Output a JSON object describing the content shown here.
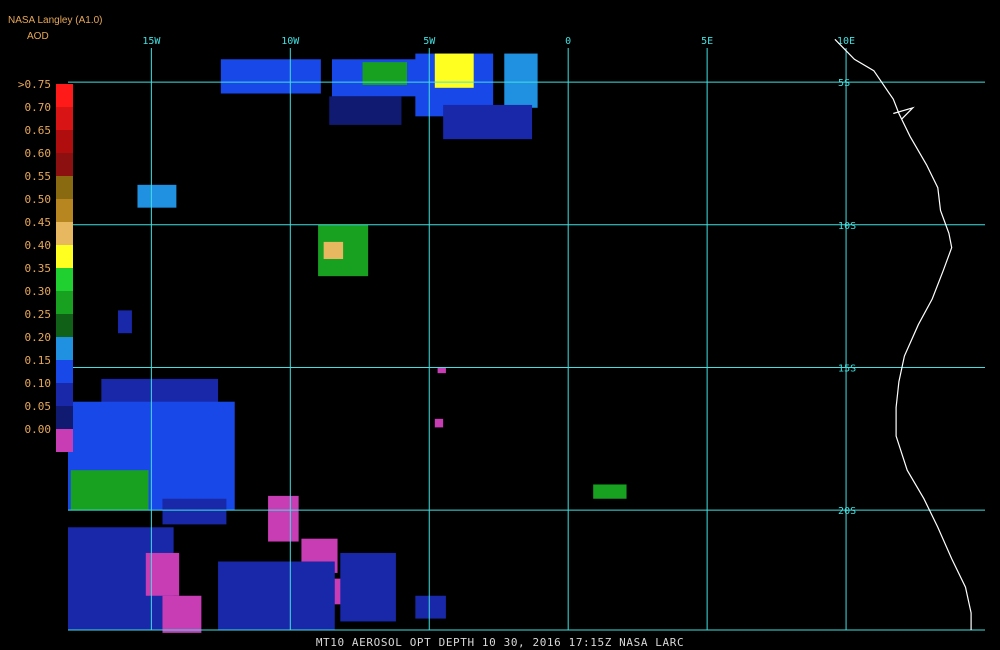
{
  "header": {
    "source": "NASA Langley (A1.0)",
    "variable": "AOD"
  },
  "footer": {
    "caption": "MT10  AEROSOL OPT DEPTH   10 30, 2016 17:15Z   NASA LARC"
  },
  "map": {
    "lon_min": -18,
    "lon_max": 15,
    "lat_max": -3.7,
    "lat_min": -24.2,
    "grid_color": "#40e0e0",
    "coast_color": "#ffffff",
    "lon_lines": [
      {
        "lon": -15,
        "label": "15W"
      },
      {
        "lon": -10,
        "label": "10W"
      },
      {
        "lon": -5,
        "label": "5W"
      },
      {
        "lon": 0,
        "label": "0"
      },
      {
        "lon": 5,
        "label": "5E"
      },
      {
        "lon": 10,
        "label": "10E"
      }
    ],
    "lat_lines": [
      {
        "lat": -5,
        "label": "5S"
      },
      {
        "lat": -10,
        "label": "10S"
      },
      {
        "lat": -15,
        "label": "15S"
      },
      {
        "lat": -20,
        "label": "20S"
      }
    ],
    "coastline": [
      [
        9.6,
        -3.5
      ],
      [
        10.3,
        -4.2
      ],
      [
        11.0,
        -4.6
      ],
      [
        11.7,
        -5.6
      ],
      [
        11.9,
        -6.1
      ],
      [
        12.3,
        -6.9
      ],
      [
        12.9,
        -7.9
      ],
      [
        13.3,
        -8.7
      ],
      [
        13.4,
        -9.5
      ],
      [
        13.7,
        -10.3
      ],
      [
        13.8,
        -10.8
      ],
      [
        13.5,
        -11.6
      ],
      [
        13.1,
        -12.6
      ],
      [
        12.6,
        -13.5
      ],
      [
        12.1,
        -14.6
      ],
      [
        11.9,
        -15.5
      ],
      [
        11.8,
        -16.4
      ],
      [
        11.8,
        -17.4
      ],
      [
        12.2,
        -18.6
      ],
      [
        12.8,
        -19.6
      ],
      [
        13.3,
        -20.6
      ],
      [
        13.8,
        -21.7
      ],
      [
        14.3,
        -22.7
      ],
      [
        14.5,
        -23.6
      ],
      [
        14.5,
        -24.2
      ]
    ],
    "coast_inlet": [
      [
        11.7,
        -6.1
      ],
      [
        12.4,
        -5.9
      ],
      [
        12.0,
        -6.3
      ]
    ],
    "aerosol_patches": [
      {
        "lon": -12.5,
        "lat": -4.2,
        "w": 3.6,
        "h": 1.2,
        "aod": 0.15
      },
      {
        "lon": -8.5,
        "lat": -4.2,
        "w": 3.5,
        "h": 1.3,
        "aod": 0.15
      },
      {
        "lon": -5.5,
        "lat": -4.0,
        "w": 2.8,
        "h": 2.2,
        "aod": 0.15
      },
      {
        "lon": -2.3,
        "lat": -4.0,
        "w": 1.2,
        "h": 1.9,
        "aod": 0.2
      },
      {
        "lon": -8.6,
        "lat": -5.5,
        "w": 2.6,
        "h": 1.0,
        "aod": 0.05
      },
      {
        "lon": -4.5,
        "lat": -5.8,
        "w": 3.2,
        "h": 1.2,
        "aod": 0.1
      },
      {
        "lon": -7.4,
        "lat": -4.3,
        "w": 1.6,
        "h": 0.8,
        "aod": 0.3
      },
      {
        "lon": -4.8,
        "lat": -4.0,
        "w": 1.4,
        "h": 1.2,
        "aod": 0.4
      },
      {
        "lon": -9.0,
        "lat": -10.0,
        "w": 1.8,
        "h": 1.8,
        "aod": 0.3
      },
      {
        "lon": -8.8,
        "lat": -10.6,
        "w": 0.7,
        "h": 0.6,
        "aod": 0.45
      },
      {
        "lon": -15.5,
        "lat": -8.6,
        "w": 1.4,
        "h": 0.8,
        "aod": 0.2
      },
      {
        "lon": -16.8,
        "lat": -15.4,
        "w": 4.2,
        "h": 2.0,
        "aod": 0.1
      },
      {
        "lon": -18.0,
        "lat": -16.2,
        "w": 6.0,
        "h": 3.8,
        "aod": 0.15
      },
      {
        "lon": -17.9,
        "lat": -18.6,
        "w": 2.8,
        "h": 1.4,
        "aod": 0.3
      },
      {
        "lon": -18.0,
        "lat": -20.6,
        "w": 3.8,
        "h": 3.6,
        "aod": 0.1
      },
      {
        "lon": -15.2,
        "lat": -21.5,
        "w": 1.2,
        "h": 1.5,
        "aod": 0.0
      },
      {
        "lon": -14.6,
        "lat": -23.0,
        "w": 1.4,
        "h": 1.3,
        "aod": 0.0
      },
      {
        "lon": -10.8,
        "lat": -19.5,
        "w": 1.1,
        "h": 1.6,
        "aod": 0.0
      },
      {
        "lon": -9.6,
        "lat": -21.0,
        "w": 1.3,
        "h": 1.2,
        "aod": 0.0
      },
      {
        "lon": -9.2,
        "lat": -22.4,
        "w": 1.4,
        "h": 0.9,
        "aod": 0.0
      },
      {
        "lon": -12.6,
        "lat": -21.8,
        "w": 4.2,
        "h": 2.4,
        "aod": 0.1
      },
      {
        "lon": -8.2,
        "lat": -21.5,
        "w": 2.0,
        "h": 2.4,
        "aod": 0.1
      },
      {
        "lon": -14.6,
        "lat": -19.6,
        "w": 2.3,
        "h": 0.9,
        "aod": 0.1
      },
      {
        "lon": -5.5,
        "lat": -23.0,
        "w": 1.1,
        "h": 0.8,
        "aod": 0.1
      },
      {
        "lon": 0.9,
        "lat": -19.1,
        "w": 1.2,
        "h": 0.5,
        "aod": 0.3
      },
      {
        "lon": -4.7,
        "lat": -15.0,
        "w": 0.3,
        "h": 0.2,
        "aod": 0.0
      },
      {
        "lon": -4.8,
        "lat": -16.8,
        "w": 0.3,
        "h": 0.3,
        "aod": 0.0
      },
      {
        "lon": -16.2,
        "lat": -13.0,
        "w": 0.5,
        "h": 0.8,
        "aod": 0.1
      }
    ]
  },
  "legend": {
    "title": "AOD",
    "bins": [
      {
        "label": ">0.75",
        "color": "#ff1a1a"
      },
      {
        "label": "0.70",
        "color": "#d81414"
      },
      {
        "label": "0.65",
        "color": "#b00e0e"
      },
      {
        "label": "0.60",
        "color": "#8c1010"
      },
      {
        "label": "0.55",
        "color": "#8a6a10"
      },
      {
        "label": "0.50",
        "color": "#b88620"
      },
      {
        "label": "0.45",
        "color": "#e8b860"
      },
      {
        "label": "0.40",
        "color": "#ffff20"
      },
      {
        "label": "0.35",
        "color": "#20d030"
      },
      {
        "label": "0.30",
        "color": "#18a020"
      },
      {
        "label": "0.25",
        "color": "#106018"
      },
      {
        "label": "0.20",
        "color": "#2090e0"
      },
      {
        "label": "0.15",
        "color": "#1848e8"
      },
      {
        "label": "0.10",
        "color": "#1828a8"
      },
      {
        "label": "0.05",
        "color": "#101a70"
      },
      {
        "label": "0.00",
        "color": "#c83cb4"
      }
    ]
  }
}
